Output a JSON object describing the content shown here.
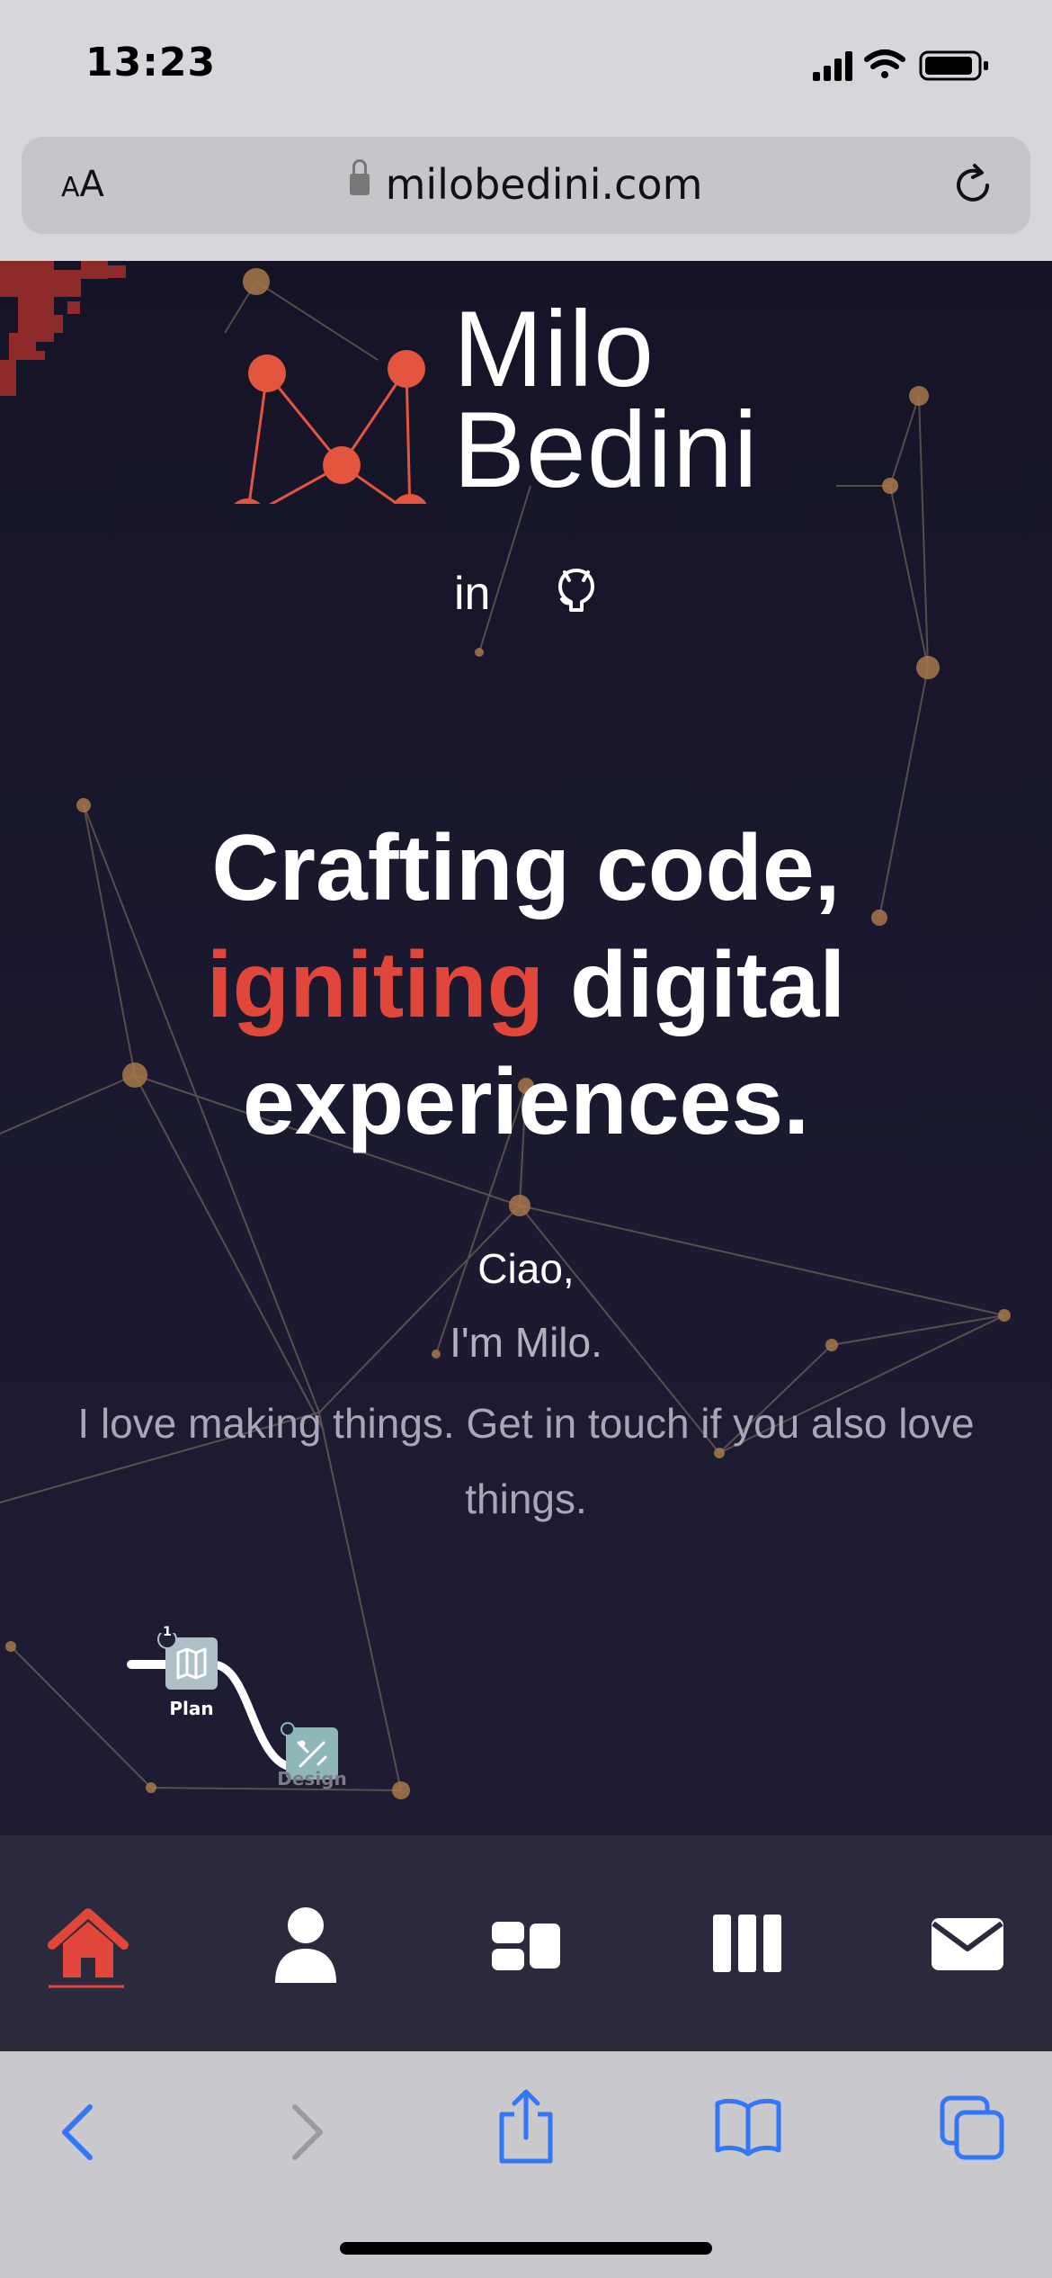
{
  "status_bar": {
    "time": "13:23"
  },
  "browser": {
    "text_size_label_small": "A",
    "text_size_label_large": "A",
    "url": "milobedini.com"
  },
  "site": {
    "brand": {
      "first_name": "Milo",
      "last_name": "Bedini"
    },
    "social": {
      "linkedin": "in",
      "github_icon": "github-icon"
    },
    "headline": {
      "line1": "Crafting code,",
      "accent": "igniting",
      "line2_rest": " digital",
      "line3": "experiences."
    },
    "greeting": "Ciao,",
    "im": "I'm Milo.",
    "intro": "I love making things. Get in touch if you also love things.",
    "flow": {
      "step1_badge": "1",
      "step1_label": "Plan",
      "step2_label": "Design"
    },
    "nav": [
      {
        "name": "home",
        "active": true
      },
      {
        "name": "about"
      },
      {
        "name": "projects"
      },
      {
        "name": "skills"
      },
      {
        "name": "contact"
      }
    ],
    "colors": {
      "accent": "#e0473a",
      "background": "#151427",
      "nav_background": "#2b2a3d"
    }
  }
}
